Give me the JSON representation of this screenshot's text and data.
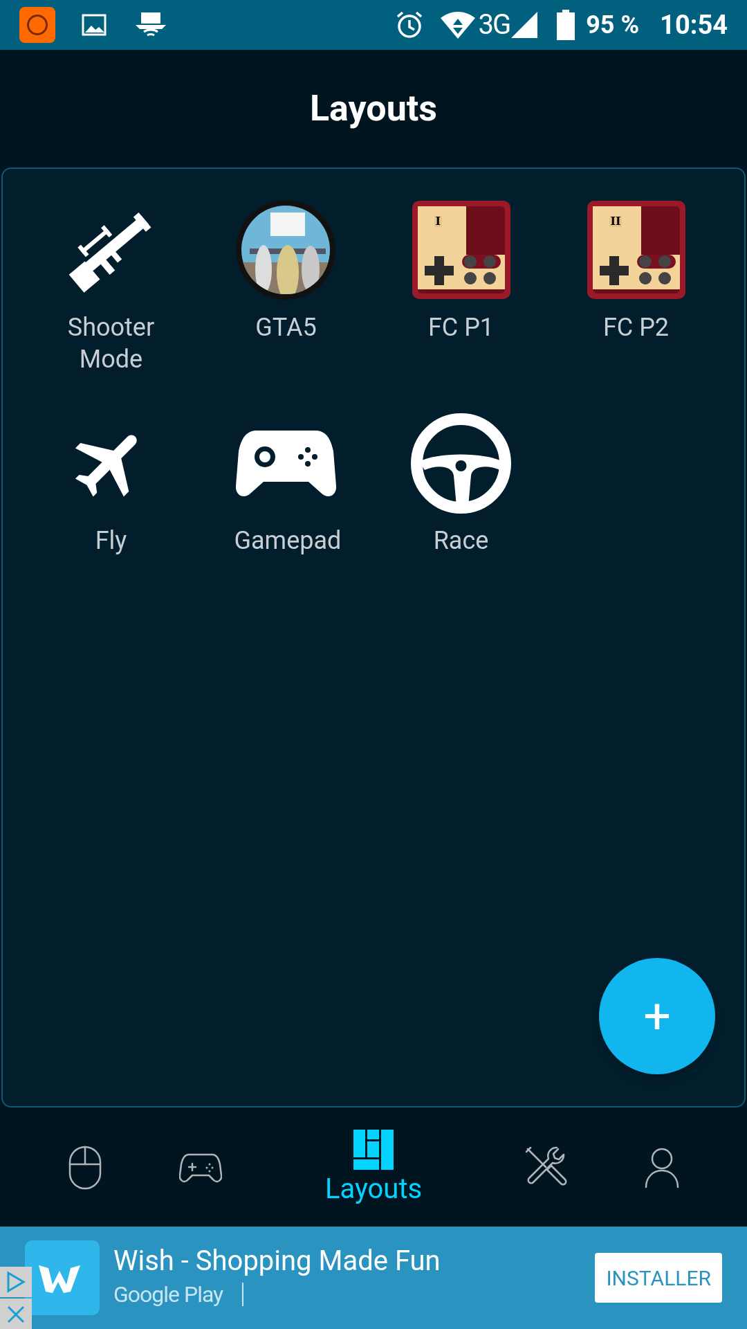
{
  "status_bar": {
    "network": "3G",
    "battery": "95 %",
    "time": "10:54"
  },
  "title": "Layouts",
  "layouts": [
    {
      "label": "Shooter Mode",
      "kind": "rifle"
    },
    {
      "label": "GTA5",
      "kind": "picture"
    },
    {
      "label": "FC P1",
      "kind": "famicom",
      "badge": "I"
    },
    {
      "label": "FC P2",
      "kind": "famicom",
      "badge": "II"
    },
    {
      "label": "Fly",
      "kind": "plane"
    },
    {
      "label": "Gamepad",
      "kind": "gamepad"
    },
    {
      "label": "Race",
      "kind": "wheel"
    }
  ],
  "add_button": {
    "label": "+"
  },
  "bottom_nav": [
    {
      "kind": "mouse",
      "selected": false
    },
    {
      "kind": "gamepad",
      "selected": false
    },
    {
      "kind": "layouts",
      "selected": true,
      "label": "Layouts"
    },
    {
      "kind": "tools",
      "selected": false
    },
    {
      "kind": "profile",
      "selected": false
    }
  ],
  "ad": {
    "title": "Wish - Shopping Made Fun",
    "store": "Google Play",
    "button": "INSTALLER"
  }
}
